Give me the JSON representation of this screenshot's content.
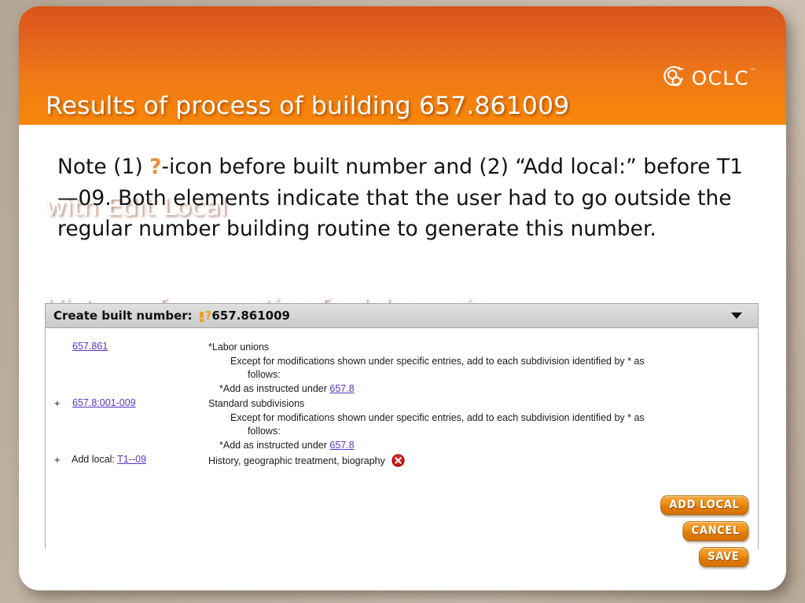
{
  "slide": {
    "header": {
      "title_lines": [
        "Results of process of building 657.861009",
        "with Edit Local",
        "History of accounting for labor unions"
      ],
      "logo": {
        "name": "OCLC",
        "wordmark": "OCLC",
        "trademark": "™",
        "icon": "oclc-swirl-icon"
      },
      "accent_color": "#f07a16"
    },
    "note": {
      "segments": [
        {
          "text": "Note (1) "
        },
        {
          "text": "?",
          "style": "accent"
        },
        {
          "text": "-icon before built number and (2) “Add local:” before T1—09.  Both elements indicate that the user had to go outside the regular number building routine to generate this number."
        }
      ],
      "accent_color": "#e8913a",
      "full_text": "Note (1) ?-icon before built number and (2) “Add local:” before T1—09.  Both elements indicate that the user had to go outside the regular number building routine to generate this number."
    },
    "panel": {
      "header": {
        "label": "Create built number:",
        "warning_icon": "warning-exclamation-icon",
        "question_mark": "?",
        "built_number": "657.861009",
        "chevron": "chevron-down-icon"
      },
      "rows": [
        {
          "plus": "",
          "prefix": "",
          "number": "657.861",
          "caption_main": "*Labor unions",
          "caption_note": "Except for modifications shown under specific entries, add to each subdivision identified by * as",
          "caption_note_cont": "follows:",
          "caption_add_prefix": "*Add as instructed under ",
          "caption_add_link": "657.8",
          "delete_icon": null
        },
        {
          "plus": "+",
          "prefix": "",
          "number": "657.8:001-009",
          "caption_main": "Standard subdivisions",
          "caption_note": "Except for modifications shown under specific entries, add to each subdivision identified by * as",
          "caption_note_cont": "follows:",
          "caption_add_prefix": "*Add as instructed under ",
          "caption_add_link": "657.8",
          "delete_icon": null
        },
        {
          "plus": "+",
          "prefix": "Add local: ",
          "number": "T1--09",
          "caption_main": "History, geographic treatment, biography",
          "caption_note": "",
          "caption_note_cont": "",
          "caption_add_prefix": "",
          "caption_add_link": "",
          "delete_icon": "delete-circle-icon"
        }
      ],
      "buttons": [
        {
          "label": "ADD LOCAL",
          "name": "add-local-button"
        },
        {
          "label": "CANCEL",
          "name": "cancel-button"
        },
        {
          "label": "SAVE",
          "name": "save-button"
        }
      ],
      "link_color": "#5a35c8",
      "button_color": "#ef8f14"
    }
  }
}
